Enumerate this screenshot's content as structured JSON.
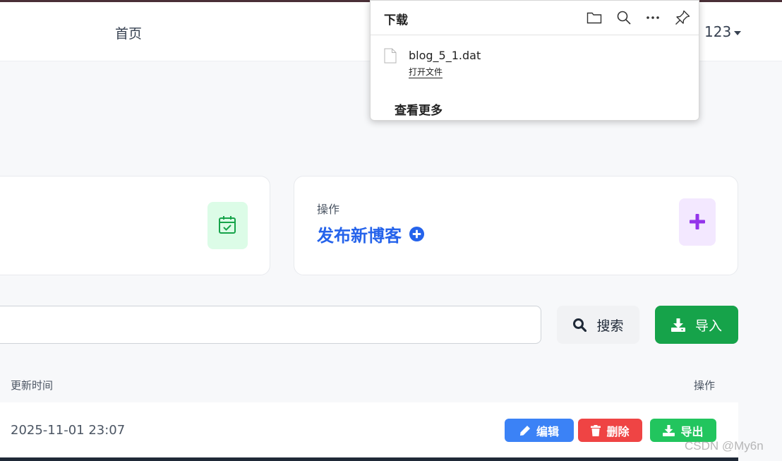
{
  "navbar": {
    "home_label": "首页",
    "user_label": "123"
  },
  "stats": {
    "action_label": "操作",
    "publish_label": "发布新博客"
  },
  "search": {
    "placeholder": "",
    "button_label": "搜索",
    "import_label": "导入"
  },
  "table": {
    "headers": {
      "updated": "更新时间",
      "actions": "操作"
    },
    "rows": [
      {
        "updated": "2025-11-01 23:07",
        "edit_label": "编辑",
        "delete_label": "删除",
        "export_label": "导出"
      }
    ]
  },
  "downloads": {
    "title": "下载",
    "file_name": "blog_5_1.dat",
    "open_file_label": "打开文件",
    "see_more_label": "查看更多"
  },
  "watermark": "CSDN @My6n",
  "colors": {
    "primary": "#2563eb",
    "success": "#16a34a",
    "danger": "#ef4444",
    "edit": "#3b82f6",
    "export": "#22c55e"
  },
  "icons": {
    "calendar": "calendar-check-icon",
    "plus": "plus-icon",
    "plus_circle": "plus-circle-icon",
    "search": "search-icon",
    "download": "download-icon",
    "pencil": "pencil-icon",
    "trash": "trash-icon",
    "folder": "folder-icon",
    "more": "more-icon",
    "pin": "pin-icon",
    "file": "file-icon"
  }
}
